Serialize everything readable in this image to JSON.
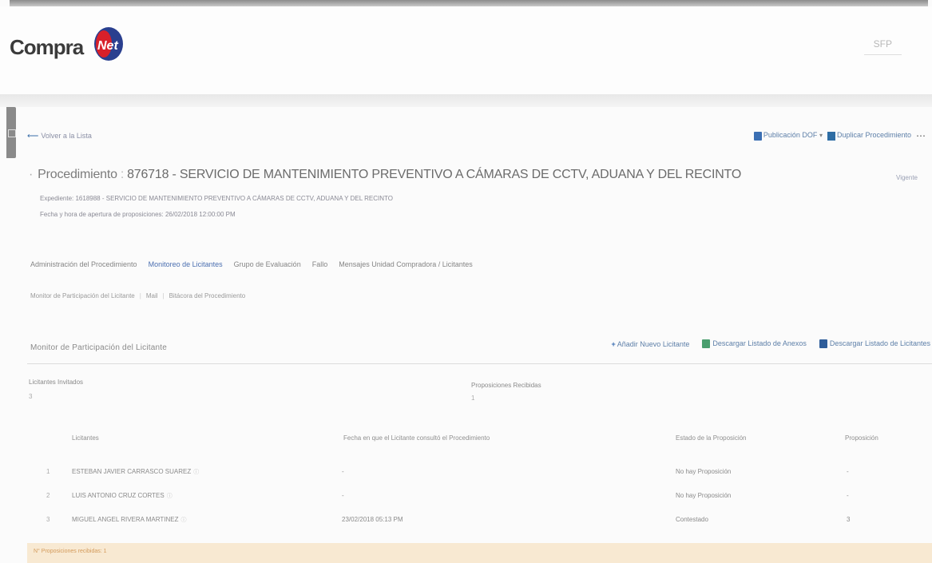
{
  "header": {
    "logo_text": "Compra",
    "logo_net": "Net",
    "right_logo": "SFP"
  },
  "back_link": "Volver a la Lista",
  "top_actions": {
    "publish": "Publicación DOF",
    "duplicate": "Duplicar Procedimiento"
  },
  "title": {
    "label": "Procedimiento",
    "text": "876718 - SERVICIO DE MANTENIMIENTO PREVENTIVO A CÁMARAS DE CCTV, ADUANA Y DEL RECINTO"
  },
  "status_link": "Vigente",
  "subtitle": {
    "expediente": "Expediente: 1618988 - SERVICIO DE MANTENIMIENTO PREVENTIVO A CÁMARAS DE CCTV, ADUANA Y DEL RECINTO",
    "fecha": "Fecha y hora de apertura de proposiciones: 26/02/2018 12:00:00 PM"
  },
  "tabs": [
    {
      "label": "Administración del Procedimiento"
    },
    {
      "label": "Monitoreo de Licitantes"
    },
    {
      "label": "Grupo de Evaluación"
    },
    {
      "label": "Fallo"
    },
    {
      "label": "Mensajes Unidad Compradora / Licitantes"
    }
  ],
  "subnav": [
    {
      "label": "Monitor de Participación del Licitante"
    },
    {
      "label": "Mail"
    },
    {
      "label": "Bitácora del Procedimiento"
    }
  ],
  "section": {
    "title": "Monitor de Participación del Licitante",
    "add": "Añadir Nuevo Licitante",
    "download_annex": "Descargar Listado de Anexos",
    "download_bidders": "Descargar Listado de Licitantes"
  },
  "stats": {
    "invited_label": "Licitantes Invitados",
    "invited_value": "3",
    "received_label": "Proposiciones Recibidas",
    "received_value": "1"
  },
  "table": {
    "headers": [
      "Licitantes",
      "Fecha en que el Licitante consultó el Procedimiento",
      "Estado de la Proposición",
      "Proposición"
    ],
    "rows": [
      {
        "n": "1",
        "name": "ESTEBAN JAVIER CARRASCO SUAREZ",
        "date": "-",
        "status": "No hay Proposición",
        "prop": "-"
      },
      {
        "n": "2",
        "name": "LUIS ANTONIO CRUZ CORTES",
        "date": "-",
        "status": "No hay Proposición",
        "prop": "-"
      },
      {
        "n": "3",
        "name": "MIGUEL ANGEL RIVERA MARTINEZ",
        "date": "23/02/2018 05:13 PM",
        "status": "Contestado",
        "prop": "3"
      }
    ]
  },
  "footer": "N° Proposiciones recibidas: 1"
}
